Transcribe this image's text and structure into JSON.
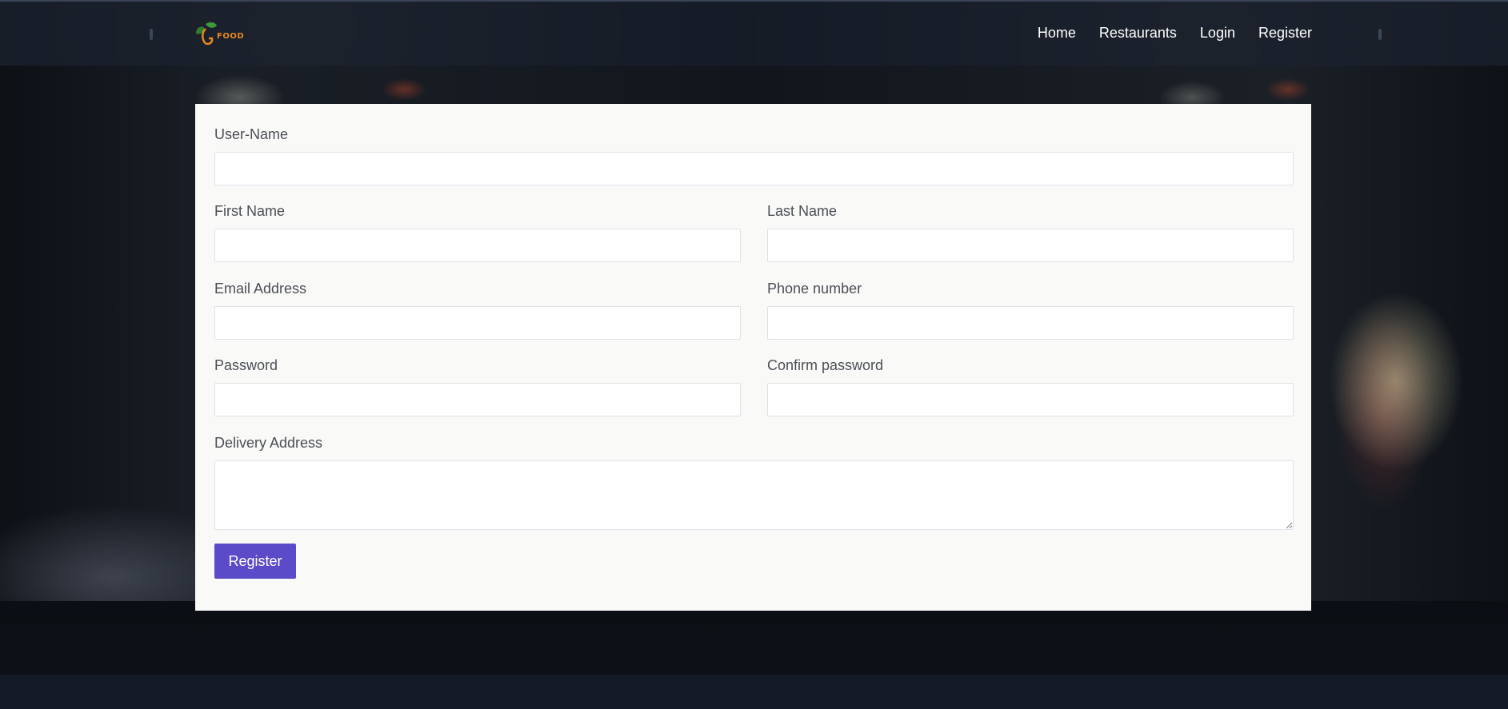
{
  "brand": {
    "logo_text": "FOOD",
    "accent_color": "#e8871e",
    "leaf_color": "#3c9a3a"
  },
  "nav": {
    "items": [
      {
        "label": "Home"
      },
      {
        "label": "Restaurants"
      },
      {
        "label": "Login"
      },
      {
        "label": "Register"
      }
    ]
  },
  "form": {
    "username": {
      "label": "User-Name",
      "value": ""
    },
    "first_name": {
      "label": "First Name",
      "value": ""
    },
    "last_name": {
      "label": "Last Name",
      "value": ""
    },
    "email": {
      "label": "Email Address",
      "value": ""
    },
    "phone": {
      "label": "Phone number",
      "value": ""
    },
    "password": {
      "label": "Password",
      "value": ""
    },
    "confirm_password": {
      "label": "Confirm password",
      "value": ""
    },
    "delivery_address": {
      "label": "Delivery Address",
      "value": ""
    },
    "submit_label": "Register",
    "submit_color": "#5b4bc9"
  }
}
